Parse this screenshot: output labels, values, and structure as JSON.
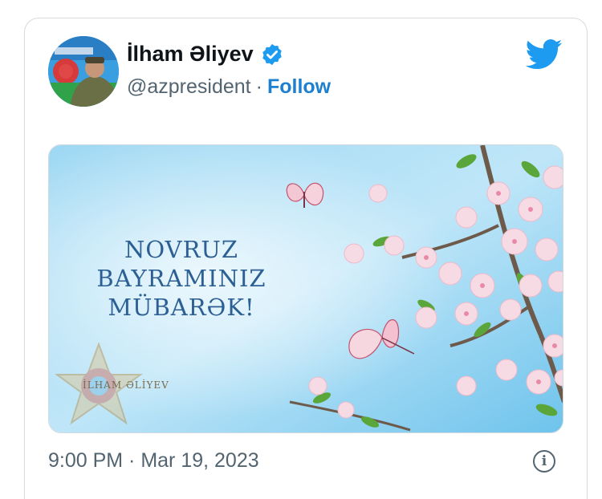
{
  "tweet": {
    "author_name": "İlham Əliyev",
    "handle": "@azpresident",
    "separator": "·",
    "follow_label": "Follow",
    "timestamp": "9:00 PM · Mar 19, 2023",
    "info_glyph": "i"
  },
  "media": {
    "greeting_lines": [
      "NOVRUZ",
      "BAYRAMINIZ",
      "MÜBARƏK!"
    ],
    "signature": "İLHAM ƏLİYEV"
  },
  "colors": {
    "brand_blue": "#1d9bf0",
    "follow_blue": "#1d7fd0",
    "greeting_text": "#2c5f93",
    "sky": "#7cc8ee"
  },
  "icons": [
    "verified-badge-icon",
    "twitter-bird-icon",
    "info-icon"
  ]
}
